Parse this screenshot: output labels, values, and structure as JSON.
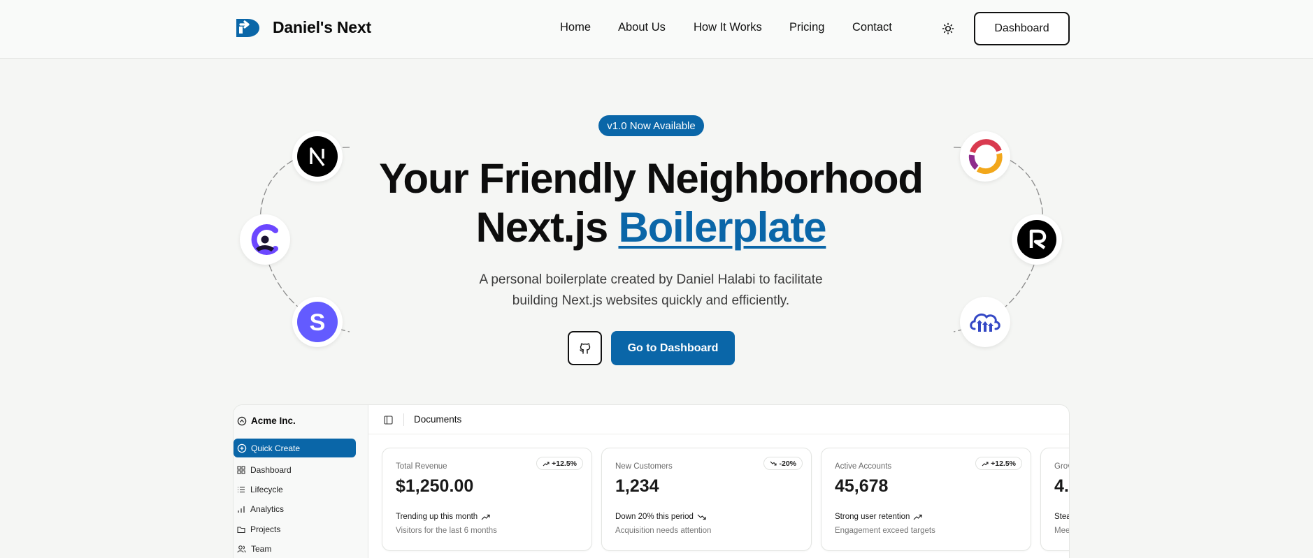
{
  "header": {
    "brand": "Daniel's Next",
    "nav": [
      "Home",
      "About Us",
      "How It Works",
      "Pricing",
      "Contact"
    ],
    "dashboard_button": "Dashboard"
  },
  "hero": {
    "badge": "v1.0 Now Available",
    "title_line1": "Your Friendly Neighborhood",
    "title_line2_prefix": "Next.js",
    "title_line2_accent": "Boilerplate",
    "subtitle_line1": "A personal boilerplate created by Daniel Halabi to facilitate",
    "subtitle_line2": "building Next.js websites quickly and efficiently.",
    "cta": "Go to Dashboard"
  },
  "tech_icons_left": [
    "nextjs-icon",
    "clerk-icon",
    "stripe-icon"
  ],
  "tech_icons_right": [
    "supabase-ring-icon",
    "resend-icon",
    "cloudinary-icon"
  ],
  "preview": {
    "org": "Acme Inc.",
    "quick_create": "Quick Create",
    "sidebar_items": [
      {
        "label": "Dashboard",
        "icon": "dashboard-icon"
      },
      {
        "label": "Lifecycle",
        "icon": "list-icon"
      },
      {
        "label": "Analytics",
        "icon": "chart-icon"
      },
      {
        "label": "Projects",
        "icon": "folder-icon"
      },
      {
        "label": "Team",
        "icon": "users-icon"
      }
    ],
    "breadcrumb": "Documents",
    "cards": [
      {
        "label": "Total Revenue",
        "value": "$1,250.00",
        "chip": "+12.5%",
        "trend": "up",
        "foot_title": "Trending up this month",
        "foot_sub": "Visitors for the last 6 months"
      },
      {
        "label": "New Customers",
        "value": "1,234",
        "chip": "-20%",
        "trend": "down",
        "foot_title": "Down 20% this period",
        "foot_sub": "Acquisition needs attention"
      },
      {
        "label": "Active Accounts",
        "value": "45,678",
        "chip": "+12.5%",
        "trend": "up",
        "foot_title": "Strong user retention",
        "foot_sub": "Engagement exceed targets"
      },
      {
        "label": "Grov",
        "value": "4.",
        "chip": "",
        "trend": "up",
        "foot_title": "Stea",
        "foot_sub": "Mee"
      }
    ]
  },
  "colors": {
    "accent": "#0a66a8",
    "background": "#f5f6f4",
    "text": "#0d0d0d"
  }
}
